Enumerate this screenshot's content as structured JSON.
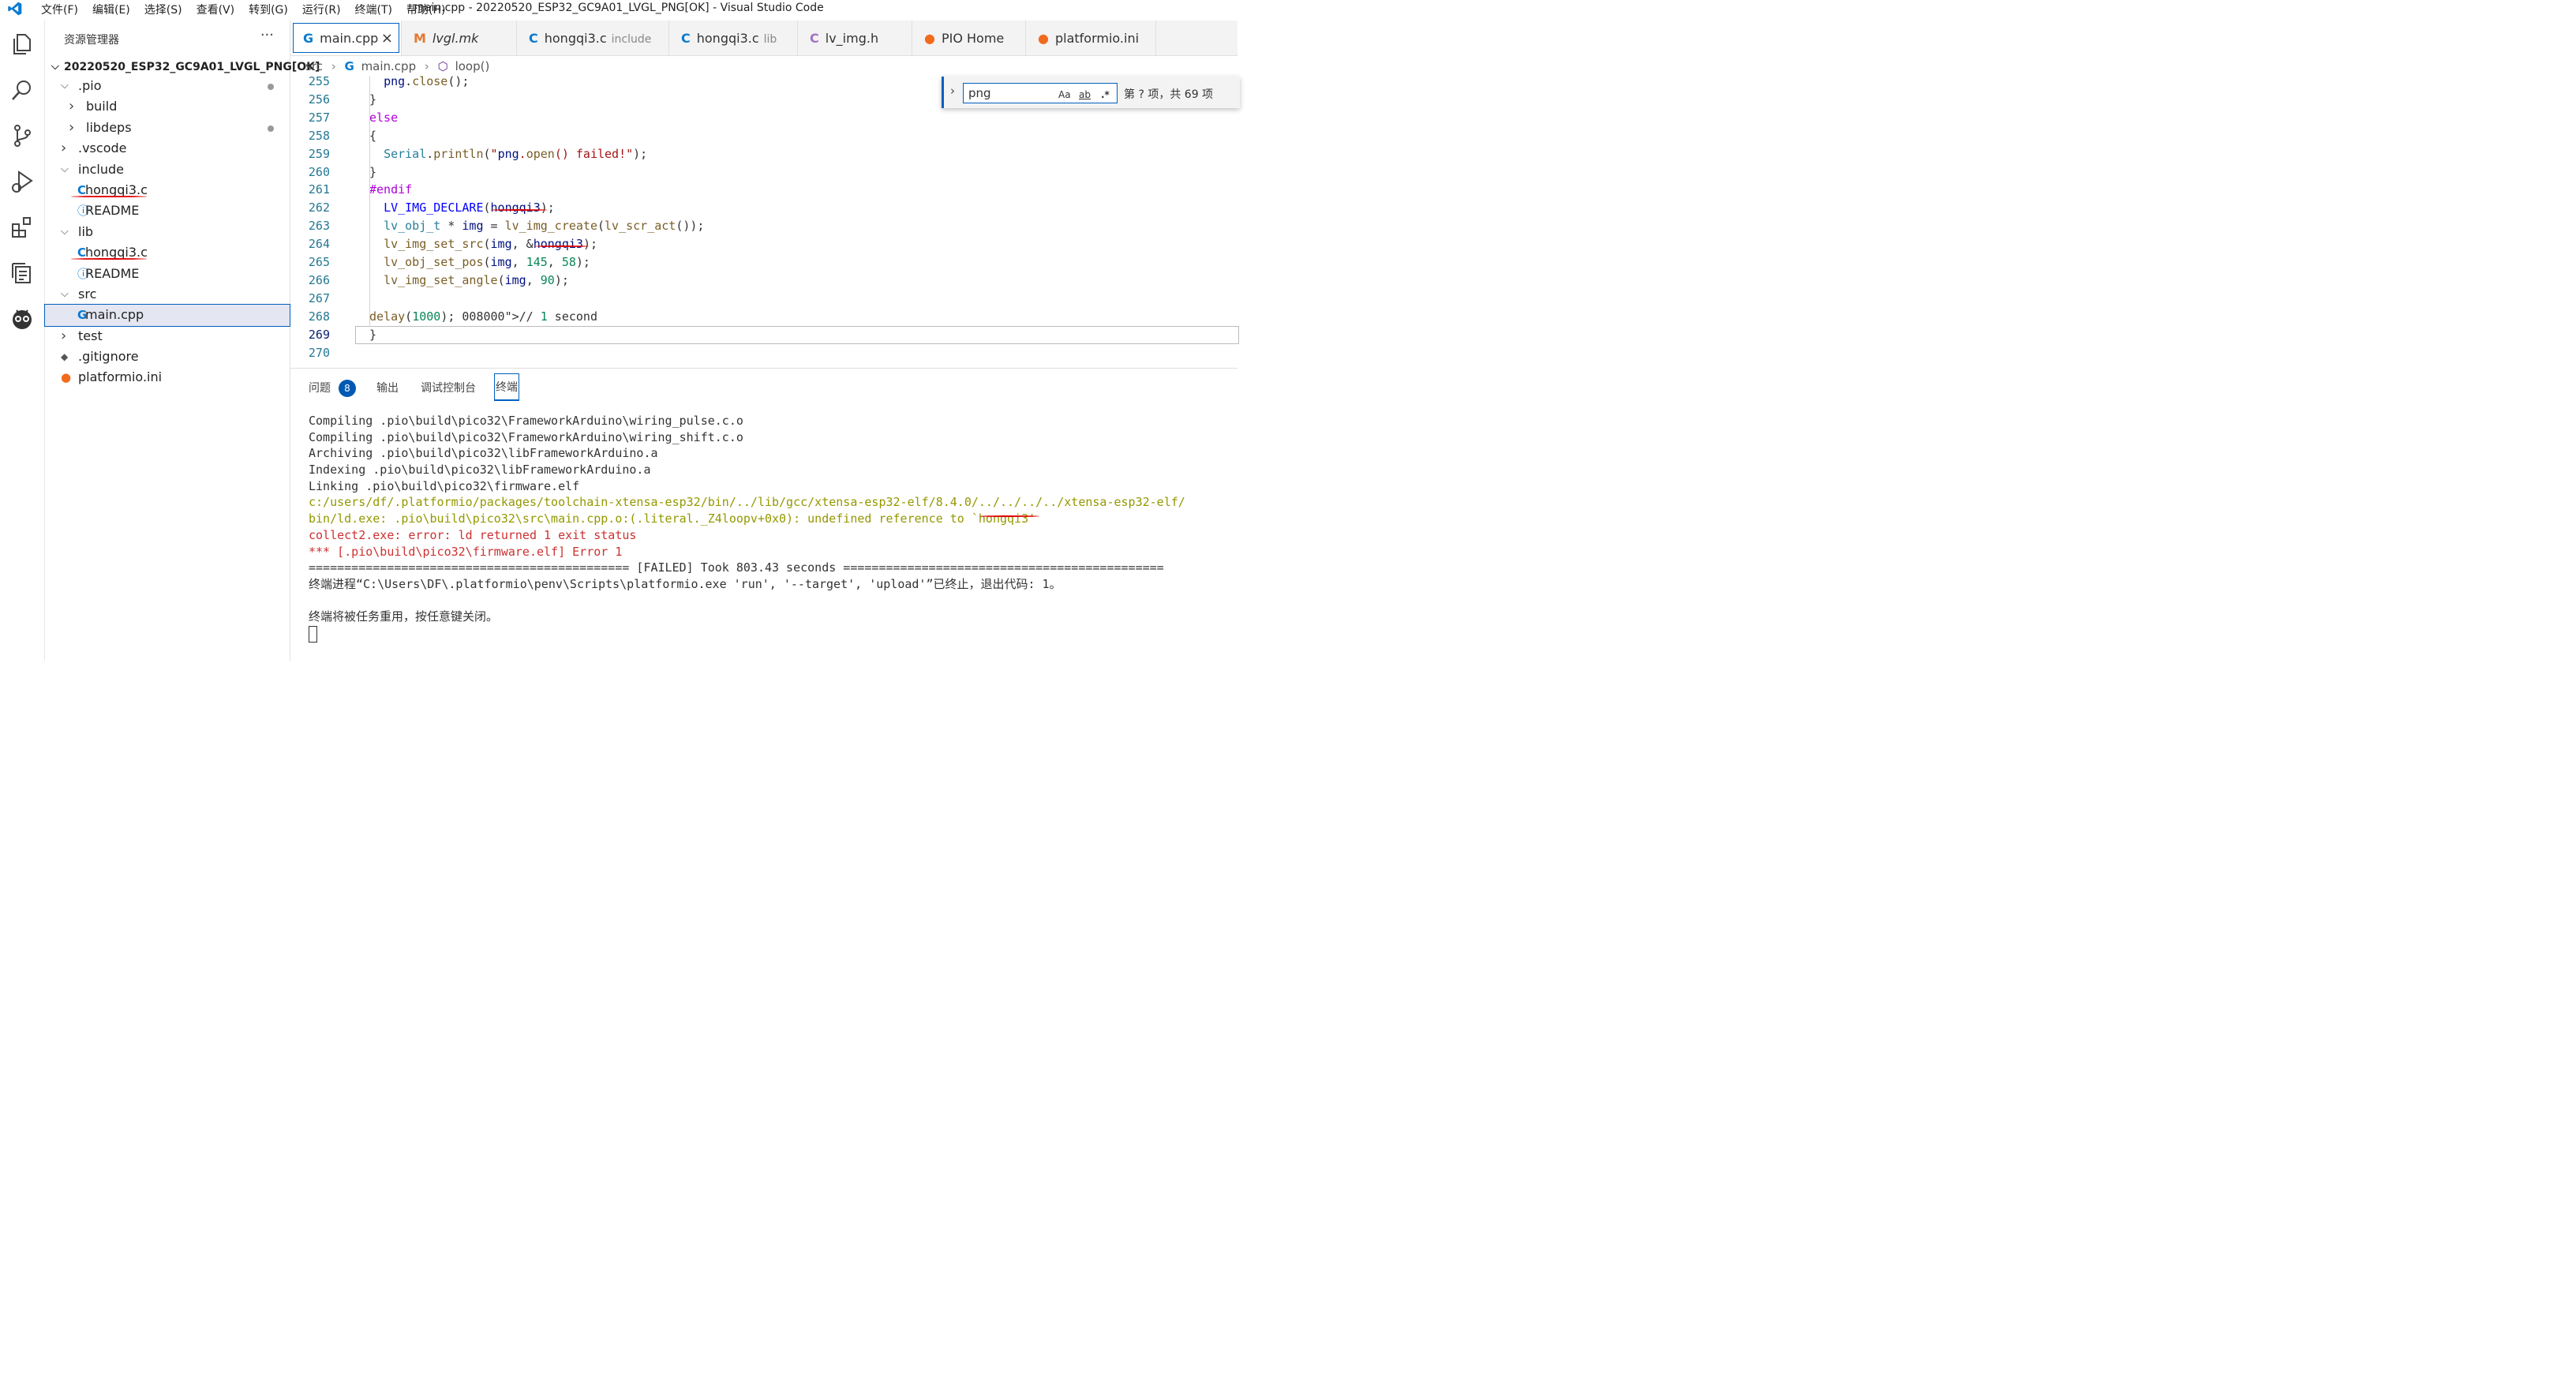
{
  "menu": [
    "文件(F)",
    "编辑(E)",
    "选择(S)",
    "查看(V)",
    "转到(G)",
    "运行(R)",
    "终端(T)",
    "帮助(H)"
  ],
  "window_title": "main.cpp - 20220520_ESP32_GC9A01_LVGL_PNG[OK] - Visual Studio Code",
  "activity_icons": [
    "explorer-icon",
    "search-icon",
    "source-control-icon",
    "run-debug-icon",
    "extensions-icon",
    "remote-explorer-icon",
    "platformio-icon"
  ],
  "sidebar": {
    "title": "资源管理器",
    "more": "···",
    "project": "20220520_ESP32_GC9A01_LVGL_PNG[OK]",
    "tree": [
      {
        "label": ".pio",
        "indent": 1,
        "chev": "down",
        "dot": true
      },
      {
        "label": "build",
        "indent": 2,
        "chev": "right",
        "dot": false
      },
      {
        "label": "libdeps",
        "indent": 2,
        "chev": "right",
        "dot": true
      },
      {
        "label": ".vscode",
        "indent": 1,
        "chev": "right",
        "dot": false
      },
      {
        "label": "include",
        "indent": 1,
        "chev": "down",
        "dot": false
      },
      {
        "label": "hongqi3.c",
        "indent": 2,
        "icon": "C",
        "dot": false,
        "underline": true
      },
      {
        "label": "README",
        "indent": 2,
        "icon": "i",
        "dot": false
      },
      {
        "label": "lib",
        "indent": 1,
        "chev": "down",
        "dot": false
      },
      {
        "label": "hongqi3.c",
        "indent": 2,
        "icon": "C",
        "dot": false,
        "underline": true
      },
      {
        "label": "README",
        "indent": 2,
        "icon": "i",
        "dot": false
      },
      {
        "label": "src",
        "indent": 1,
        "chev": "down",
        "dot": false
      },
      {
        "label": "main.cpp",
        "indent": 2,
        "icon": "cpp",
        "dot": false,
        "selected": true
      },
      {
        "label": "test",
        "indent": 1,
        "chev": "right",
        "dot": false
      },
      {
        "label": ".gitignore",
        "indent": 1,
        "icon": "git",
        "dot": false
      },
      {
        "label": "platformio.ini",
        "indent": 1,
        "icon": "pio",
        "dot": false
      }
    ]
  },
  "tabs": [
    {
      "label": "main.cpp",
      "sub": "",
      "icon": "G",
      "active": true,
      "close": "×"
    },
    {
      "label": "lvgl.mk",
      "sub": "",
      "icon": "M"
    },
    {
      "label": "hongqi3.c",
      "sub": "include",
      "icon": "C"
    },
    {
      "label": "hongqi3.c",
      "sub": "lib",
      "icon": "C"
    },
    {
      "label": "lv_img.h",
      "sub": "",
      "icon": "C"
    },
    {
      "label": "PIO Home",
      "sub": "",
      "icon": "pio"
    },
    {
      "label": "platformio.ini",
      "sub": "",
      "icon": "pio"
    }
  ],
  "breadcrumb": [
    "src",
    "main.cpp",
    "loop()"
  ],
  "find": {
    "value": "png",
    "case": "Aa",
    "word": "ab",
    "regex": ".*",
    "count": "第 ? 项，共 69 项"
  },
  "code": [
    {
      "n": "255",
      "t": "  png.close();"
    },
    {
      "n": "256",
      "t": "}"
    },
    {
      "n": "257",
      "t": "else"
    },
    {
      "n": "258",
      "t": "{"
    },
    {
      "n": "259",
      "t": "  Serial.println(\"png.open() failed!\");"
    },
    {
      "n": "260",
      "t": "}"
    },
    {
      "n": "261",
      "t": "#endif"
    },
    {
      "n": "262",
      "t": "  LV_IMG_DECLARE(hongqi3);"
    },
    {
      "n": "263",
      "t": "  lv_obj_t * img = lv_img_create(lv_scr_act());"
    },
    {
      "n": "264",
      "t": "  lv_img_set_src(img, &hongqi3);"
    },
    {
      "n": "265",
      "t": "  lv_obj_set_pos(img, 145, 58);"
    },
    {
      "n": "266",
      "t": "  lv_img_set_angle(img, 90);"
    },
    {
      "n": "267",
      "t": ""
    },
    {
      "n": "268",
      "t": "delay(1000); // 1 second"
    },
    {
      "n": "269",
      "t": "}"
    },
    {
      "n": "270",
      "t": ""
    }
  ],
  "panel": {
    "tabs": [
      "问题",
      "输出",
      "调试控制台",
      "终端"
    ],
    "problems_count": "8",
    "terminal": [
      {
        "t": "Compiling .pio\\build\\pico32\\FrameworkArduino\\wiring_pulse.c.o",
        "c": "#333333"
      },
      {
        "t": "Compiling .pio\\build\\pico32\\FrameworkArduino\\wiring_shift.c.o",
        "c": "#333333"
      },
      {
        "t": "Archiving .pio\\build\\pico32\\libFrameworkArduino.a",
        "c": "#333333"
      },
      {
        "t": "Indexing .pio\\build\\pico32\\libFrameworkArduino.a",
        "c": "#333333"
      },
      {
        "t": "Linking .pio\\build\\pico32\\firmware.elf",
        "c": "#333333"
      },
      {
        "t": "c:/users/df/.platformio/packages/toolchain-xtensa-esp32/bin/../lib/gcc/xtensa-esp32-elf/8.4.0/../../../../xtensa-esp32-elf/",
        "c": "#949800"
      },
      {
        "t": "bin/ld.exe: .pio\\build\\pico32\\src\\main.cpp.o:(.literal._Z4loopv+0x0): undefined reference to `hongqi3'",
        "c": "#949800"
      },
      {
        "t": "collect2.exe: error: ld returned 1 exit status",
        "c": "#cd3131"
      },
      {
        "t": "*** [.pio\\build\\pico32\\firmware.elf] Error 1",
        "c": "#cd3131"
      },
      {
        "t": "============================================= [FAILED] Took 803.43 seconds =============================================",
        "c": "#333333"
      },
      {
        "t": "终端进程“C:\\Users\\DF\\.platformio\\penv\\Scripts\\platformio.exe 'run', '--target', 'upload'”已终止，退出代码: 1。",
        "c": "#333333"
      },
      {
        "t": "",
        "c": "#333333"
      },
      {
        "t": "终端将被任务重用，按任意键关闭。",
        "c": "#333333"
      }
    ]
  },
  "colors": {
    "accent": "#0060c0",
    "keyword": "#af00db",
    "function": "#795e26",
    "number": "#098658",
    "string": "#a31515",
    "error": "#cd3131",
    "warning": "#949800"
  }
}
